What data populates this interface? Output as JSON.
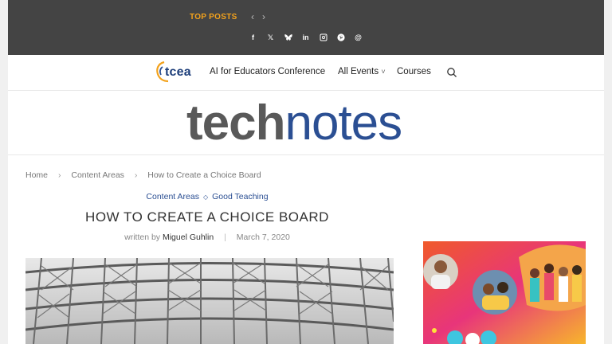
{
  "topbar": {
    "top_posts_label": "TOP POSTS",
    "prev_icon": "chevron-left-icon",
    "next_icon": "chevron-right-icon",
    "social_icons": [
      "facebook-icon",
      "x-icon",
      "bluesky-icon",
      "linkedin-icon",
      "instagram-icon",
      "pinterest-icon",
      "threads-icon"
    ],
    "background_color": "#444444",
    "accent_color": "#f3a21c"
  },
  "nav": {
    "logo_text": "tcea",
    "items": [
      "AI for Educators Conference",
      "All Events",
      "Courses"
    ],
    "all_events_caret": "˅",
    "search_icon": "search-icon"
  },
  "brand": {
    "part1": "tech",
    "part2": "notes",
    "part1_color": "#595959",
    "part2_color": "#2b4f93"
  },
  "breadcrumb": {
    "items": [
      "Home",
      "Content Areas",
      "How to Create a Choice Board"
    ],
    "separator": "›"
  },
  "article": {
    "categories": [
      "Content Areas",
      "Good Teaching"
    ],
    "title": "HOW TO CREATE A CHOICE BOARD",
    "written_by": "written by",
    "author": "Miguel Guhlin",
    "date": "March 7, 2020"
  }
}
